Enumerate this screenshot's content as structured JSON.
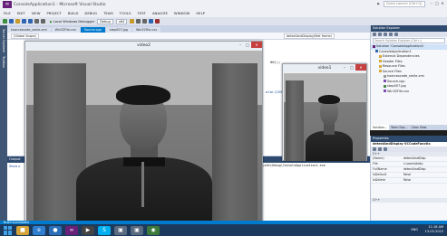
{
  "titlebar": {
    "title": "ConsoleApplication1 - Microsoft Visual Studio",
    "quick_launch_placeholder": "Quick Launch (Ctrl+Q)",
    "user": "Santosh Hegde"
  },
  "menu": [
    "FILE",
    "EDIT",
    "VIEW",
    "PROJECT",
    "BUILD",
    "DEBUG",
    "TEAM",
    "TOOLS",
    "TEST",
    "ANALYZE",
    "WINDOW",
    "HELP"
  ],
  "toolbar": {
    "run_label": "Local Windows Debugger",
    "config": "Debug",
    "platform": "x64"
  },
  "doc_tabs": [
    "haarcascade_smile.xml",
    "Win32File.cxx",
    "Source.cpp",
    "step007.jpg",
    "Win32File.cxx"
  ],
  "nav_bar": {
    "scope": "(Global Scope)",
    "member": "detectAndDisplay(Mat frame)"
  },
  "left_gutter": [
    "Server Explorer",
    "Toolbox"
  ],
  "editor": {
    "line1": "00));",
    "line2": "alar(255, 255"
  },
  "output": {
    "title": "Output",
    "show_from": "Show o",
    "line": "(tcutions\\x64\\Debug\\ConsoleApplication1.exe"
  },
  "bottom_tabs": [
    "Error List",
    "Output"
  ],
  "status_text": "Build succeeded",
  "solution_explorer": {
    "title": "Solution Explorer",
    "search_placeholder": "Search Solution Explorer (Ctrl+;)",
    "items": [
      "Solution 'ConsoleApplication1'",
      "ConsoleApplication1",
      "External Dependencies",
      "Header Files",
      "Resource Files",
      "Source Files",
      "haarcascade_smile.xml",
      "Source.cpp",
      "step007.jpg",
      "Win32File.cxx"
    ],
    "bottom_tabs": [
      "Solution...",
      "Team Exp...",
      "Class View"
    ]
  },
  "properties": {
    "title": "Properties",
    "subject": "detectAndDisplay VCCodeFunctio",
    "section": "C++",
    "rows": [
      {
        "key": "(Name)",
        "value": "detectAndDisp"
      },
      {
        "key": "File",
        "value": "c:\\users\\tollp"
      },
      {
        "key": "FullName",
        "value": "detectAndDisp"
      },
      {
        "key": "IsDefault",
        "value": "False"
      },
      {
        "key": "IsDelete",
        "value": "False"
      }
    ],
    "footer": "C++"
  },
  "cv_windows": {
    "main_title": "video2",
    "small_title": "video1"
  },
  "taskbar": {
    "lang": "ENG",
    "time": "11:18 AM",
    "date": "13-03-2015"
  }
}
